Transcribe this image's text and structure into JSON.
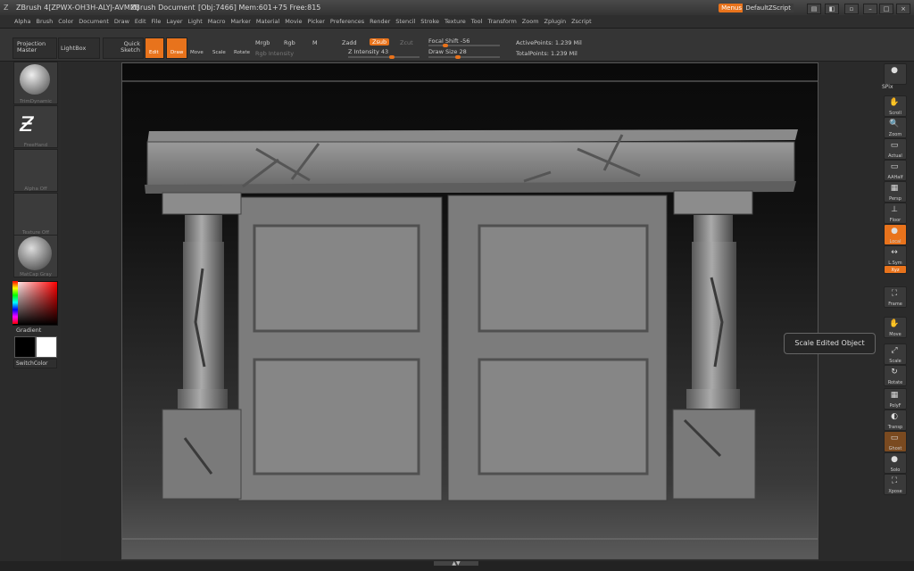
{
  "titlebar": {
    "app": "ZBrush 4[ZPWX-OH3H-ALYJ-AVMM]",
    "document": "ZBrush Document",
    "stats": "[Obj:7466] Mem:601+75 Free:815",
    "menus_label": "Menus",
    "script_label": "DefaultZScript"
  },
  "menubar": [
    "Alpha",
    "Brush",
    "Color",
    "Document",
    "Draw",
    "Edit",
    "File",
    "Layer",
    "Light",
    "Macro",
    "Marker",
    "Material",
    "Movie",
    "Picker",
    "Preferences",
    "Render",
    "Stencil",
    "Stroke",
    "Texture",
    "Tool",
    "Transform",
    "Zoom",
    "Zplugin",
    "Zscript"
  ],
  "toolbar": {
    "projection_master": "Projection Master",
    "lightbox": "LightBox",
    "quick_sketch": "Quick Sketch",
    "edit": "Edit",
    "draw": "Draw",
    "move": "Move",
    "scale": "Scale",
    "rotate": "Rotate",
    "mrgb": "Mrgb",
    "rgb": "Rgb",
    "m": "M",
    "rgb_intensity": "Rgb Intensity",
    "zadd": "Zadd",
    "zsub": "Zsub",
    "zcut": "Zcut",
    "z_intensity": "Z Intensity 43",
    "focal_shift": "Focal Shift -56",
    "draw_size": "Draw Size 28",
    "active_points": "ActivePoints: 1.239 Mil",
    "total_points": "TotalPoints: 1.239 Mil"
  },
  "left": {
    "brush_label": "TrimDynamic",
    "stroke_label": "FreeHand",
    "alpha_label": "Alpha Off",
    "texture_label": "Texture Off",
    "material_label": "MatCap Gray",
    "gradient_label": "Gradient",
    "switch_label": "SwitchColor"
  },
  "right": {
    "spix": "SPix",
    "buttons": [
      "Scroll",
      "Zoom",
      "Actual",
      "AAHalf",
      "Persp",
      "Floor",
      "Local",
      "L.Sym",
      "Xyz",
      "Frame",
      "Move",
      "Scale",
      "Rotate",
      "PolyF",
      "Transp",
      "Ghost",
      "Solo",
      "Xpose"
    ]
  },
  "tooltip": "Scale Edited Object"
}
